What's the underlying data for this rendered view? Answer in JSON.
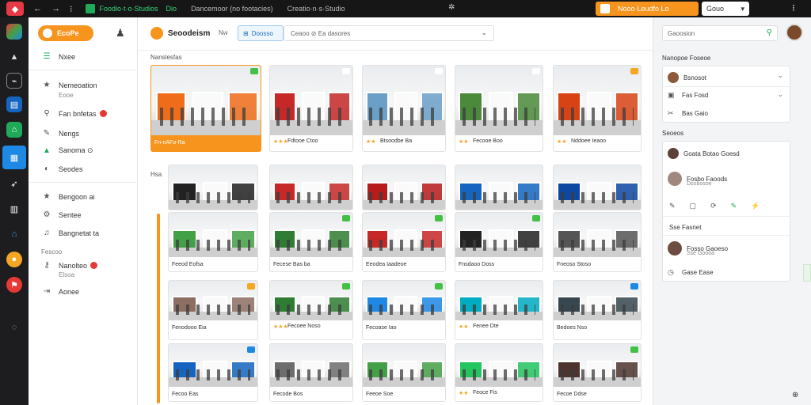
{
  "topbar": {
    "back": "←",
    "forward": "→",
    "more": "⁝",
    "tab_active": "Foodio·t·o·Studios",
    "tab_label": "Dio",
    "tab2": "Dancemoor (no footacies)",
    "tab3": "Creatio·n·s·Studio",
    "center_icon": "✲",
    "orange_button": "Nooo·Leudfo Lo",
    "white_button": "Gouo",
    "white_caret": "▾",
    "menu": "⁝"
  },
  "nav": {
    "brand": "EcoPe",
    "items": [
      {
        "label": "Nxee",
        "icon": "list-icon"
      },
      {
        "label": "Nemeoation",
        "icon": "star-icon",
        "sub": "Eooe"
      },
      {
        "label": "Fan bnfetas",
        "icon": "search-icon",
        "badge": true
      },
      {
        "label": "Nengs",
        "icon": "edit-icon"
      },
      {
        "label": "Sanoma ⊙",
        "icon": "alert-icon"
      },
      {
        "label": "Seodes",
        "icon": "palette-icon"
      },
      {
        "label": "Bengoon ai",
        "icon": "star-icon"
      },
      {
        "label": "Sentee",
        "icon": "gear-icon"
      },
      {
        "label": "Bangnetat ta",
        "icon": "bell-icon"
      },
      {
        "label": "Nanolteo",
        "icon": "key-icon",
        "badge": true,
        "sub": "Elsoa"
      },
      {
        "label": "Aonee",
        "icon": "logout-icon"
      }
    ],
    "section_label": "Fescoo"
  },
  "main": {
    "title": "Seoodeism",
    "format_label": "Nw",
    "filter_label": "Doosso",
    "select_label": "Ceaoo  ⊘  Ea dasores",
    "section_title": "Nanslesfas",
    "side_label": "Hsa",
    "cards": [
      {
        "caption": "Fn-nAFo-Ra",
        "stars": "",
        "highlight": true,
        "color": "#ef6c1a",
        "chip": "#43c046"
      },
      {
        "caption": "Fdtooe Ctoo",
        "stars": "★★★",
        "highlight": false,
        "color": "#c62828",
        "chip": "#ffffff"
      },
      {
        "caption": "Btsoodbe Ba",
        "stars": "★★",
        "highlight": false,
        "color": "#6aa0c8",
        "chip": "#ffffff"
      },
      {
        "caption": "Fecooe Boo",
        "stars": "★★",
        "highlight": false,
        "color": "#4a8a3a",
        "chip": "#ffffff"
      },
      {
        "caption": "Nddoee Ieaoo",
        "stars": "★★",
        "highlight": false,
        "color": "#d84315",
        "chip": "#f5a623"
      },
      {
        "caption": "",
        "stars": "",
        "highlight": false,
        "color": "#222222",
        "chip": ""
      },
      {
        "caption": "",
        "stars": "",
        "highlight": false,
        "color": "#c62828",
        "chip": ""
      },
      {
        "caption": "",
        "stars": "",
        "highlight": false,
        "color": "#b71c1c",
        "chip": ""
      },
      {
        "caption": "",
        "stars": "",
        "highlight": false,
        "color": "#1565c0",
        "chip": ""
      },
      {
        "caption": "",
        "stars": "",
        "highlight": false,
        "color": "#0d47a1",
        "chip": ""
      },
      {
        "caption": "Feeod Eofsa",
        "stars": "",
        "highlight": false,
        "color": "#43a047",
        "chip": ""
      },
      {
        "caption": "Fecese Bas ba",
        "stars": "",
        "highlight": false,
        "color": "#2e7d32",
        "chip": "#43c046"
      },
      {
        "caption": "Eeodea Iaadeoe",
        "stars": "",
        "highlight": false,
        "color": "#c62828",
        "chip": "#43c046"
      },
      {
        "caption": "Fnsdaoo Doss",
        "stars": "",
        "highlight": false,
        "color": "#222222",
        "chip": "#43c046"
      },
      {
        "caption": "Fneoso Stoso",
        "stars": "",
        "highlight": false,
        "color": "#555555",
        "chip": ""
      },
      {
        "caption": "Fenodooo Eia",
        "stars": "",
        "highlight": false,
        "color": "#8d6e63",
        "chip": "#f5a623"
      },
      {
        "caption": "Fecoee Noso",
        "stars": "★★★",
        "highlight": false,
        "color": "#2e7d32",
        "chip": "#43c046"
      },
      {
        "caption": "Fecoase Iao",
        "stars": "",
        "highlight": false,
        "color": "#1e88e5",
        "chip": "#43c046"
      },
      {
        "caption": "Fenee Dte",
        "stars": "★★",
        "highlight": false,
        "color": "#00acc1",
        "chip": ""
      },
      {
        "caption": "Bedoes Nso",
        "stars": "",
        "highlight": false,
        "color": "#37474f",
        "chip": "#1e88e5"
      },
      {
        "caption": "Fecoo Eas",
        "stars": "",
        "highlight": false,
        "color": "#1565c0",
        "chip": "#1e88e5"
      },
      {
        "caption": "Fecode Bos",
        "stars": "",
        "highlight": false,
        "color": "#6d6d6d",
        "chip": ""
      },
      {
        "caption": "Feeoe Soe",
        "stars": "",
        "highlight": false,
        "color": "#43a047",
        "chip": ""
      },
      {
        "caption": "Feoce Fis",
        "stars": "★★",
        "highlight": false,
        "color": "#22c55e",
        "chip": ""
      },
      {
        "caption": "Fecoe Ddse",
        "stars": "",
        "highlight": false,
        "color": "#4e342e",
        "chip": "#43c046"
      }
    ]
  },
  "right": {
    "search_placeholder": "Gaoosion",
    "panel_title": "Nanopoe Foseoe",
    "filters": [
      {
        "label": "Bsnosot",
        "icon": "avatar",
        "chev": "⌄"
      },
      {
        "label": "Fas Fosd",
        "icon": "box-icon",
        "chev": "⌄"
      },
      {
        "label": "Bas Gaio",
        "icon": "tool-icon",
        "chev": ""
      }
    ],
    "section_label": "Seoeos",
    "people": [
      {
        "name": "Goata Botao Goesd",
        "sub": ""
      },
      {
        "name": "Fosbo Faoods",
        "sub": "Dsobosoe"
      }
    ],
    "actions": [
      "✎",
      "▢",
      "⟳",
      "✎",
      "⚡"
    ],
    "saved_title": "Sse Fasnet",
    "saved_person": "Fosso Gaoeso",
    "saved_sub": "Sse Goooa",
    "saved_extra": "Gase Ease"
  }
}
